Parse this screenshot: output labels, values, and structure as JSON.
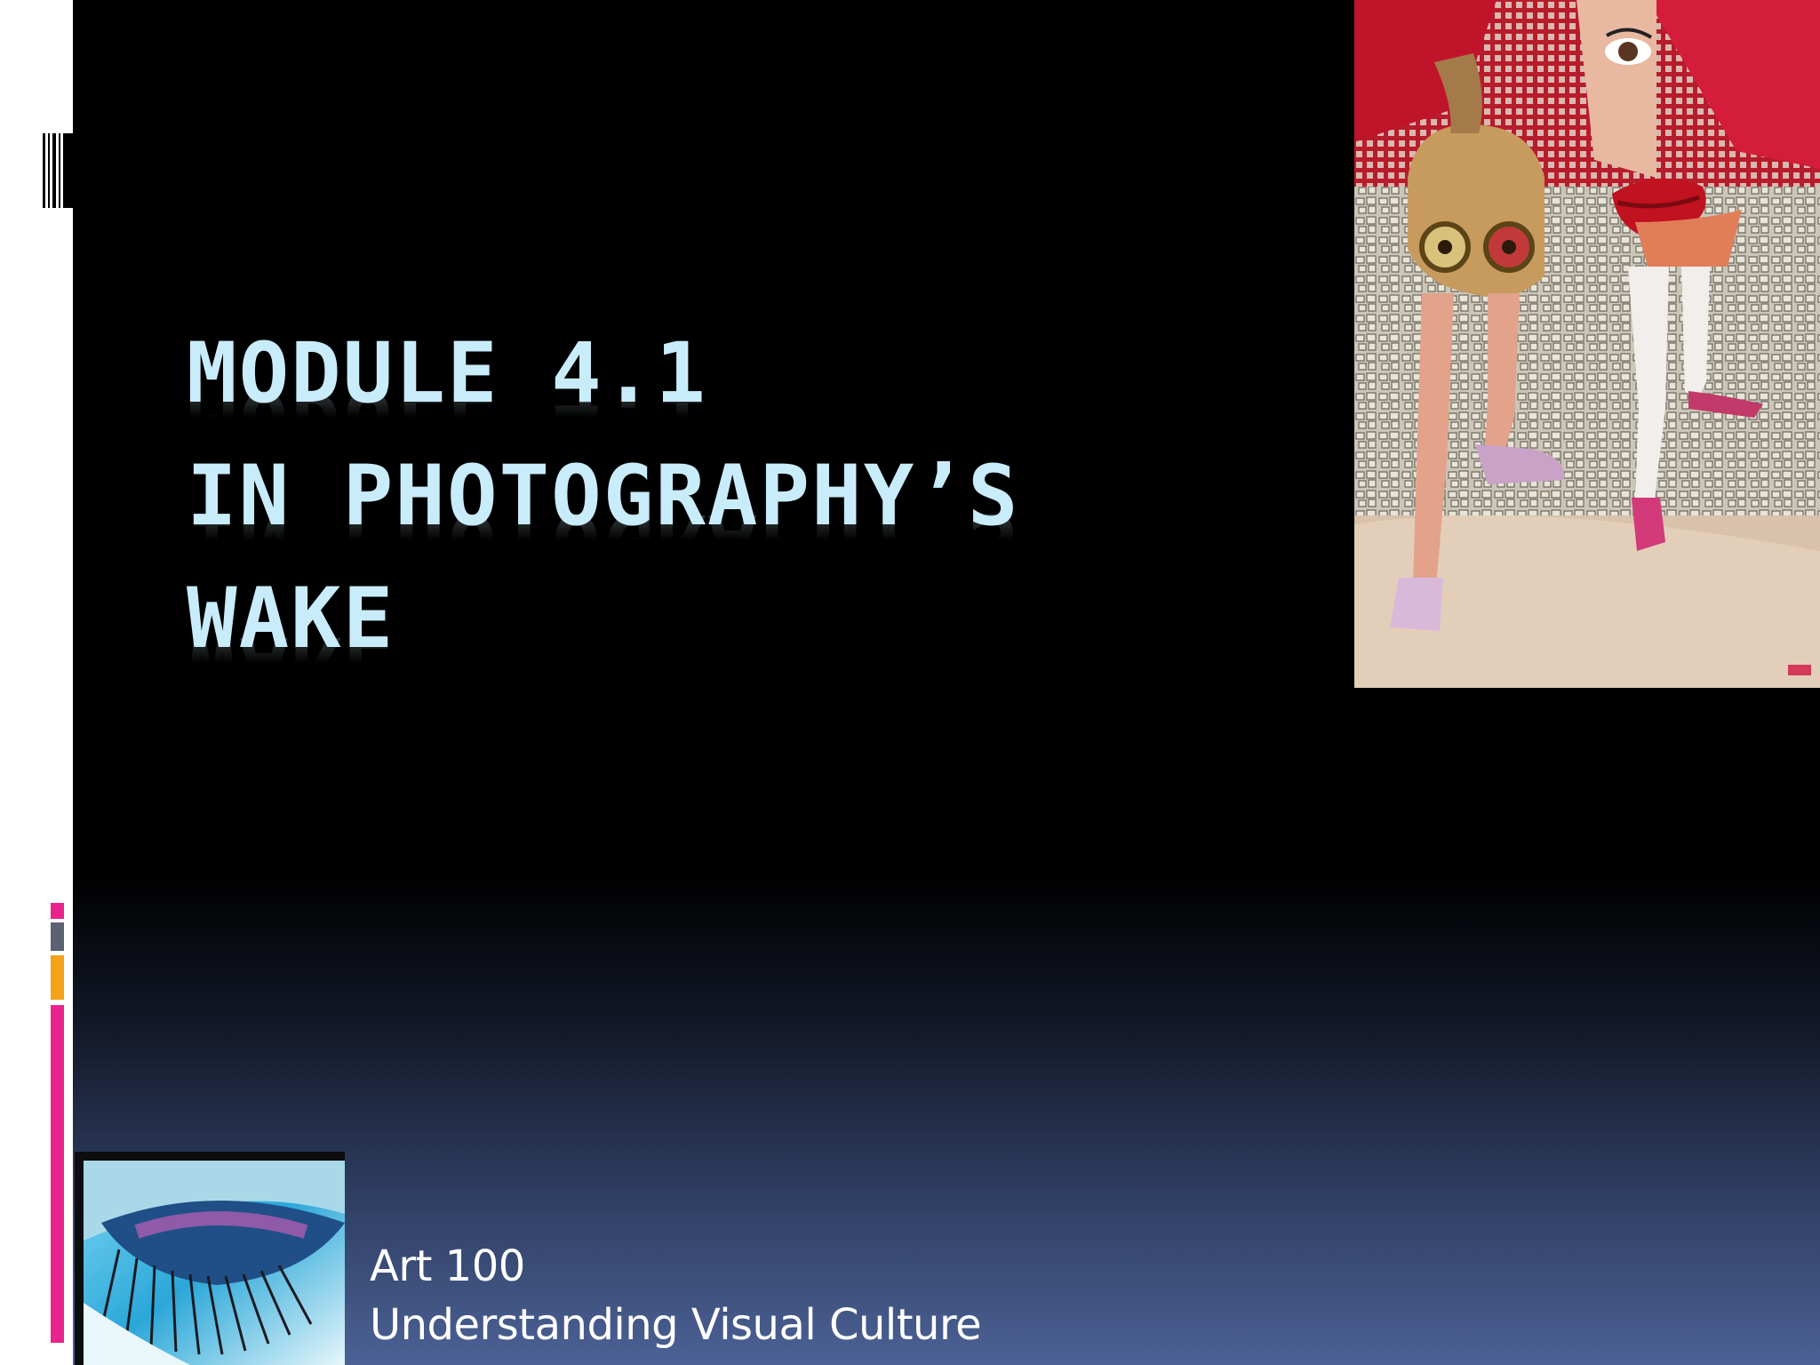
{
  "slide": {
    "title_lines": [
      "MODULE 4.1",
      "IN PHOTOGRAPHY’S",
      "WAKE"
    ],
    "subtitle_lines": [
      "Art 100",
      "Understanding Visual Culture"
    ]
  },
  "colors": {
    "title": "#c9ecfb",
    "background_top": "#000000",
    "background_bottom": "#4c6296",
    "accent_pink": "#e8248c",
    "accent_orange": "#f3a21a",
    "accent_slate": "#5b6274"
  },
  "images": {
    "collage": "photomontage-collage-image",
    "thumbnail": "eye-closeup-image"
  }
}
